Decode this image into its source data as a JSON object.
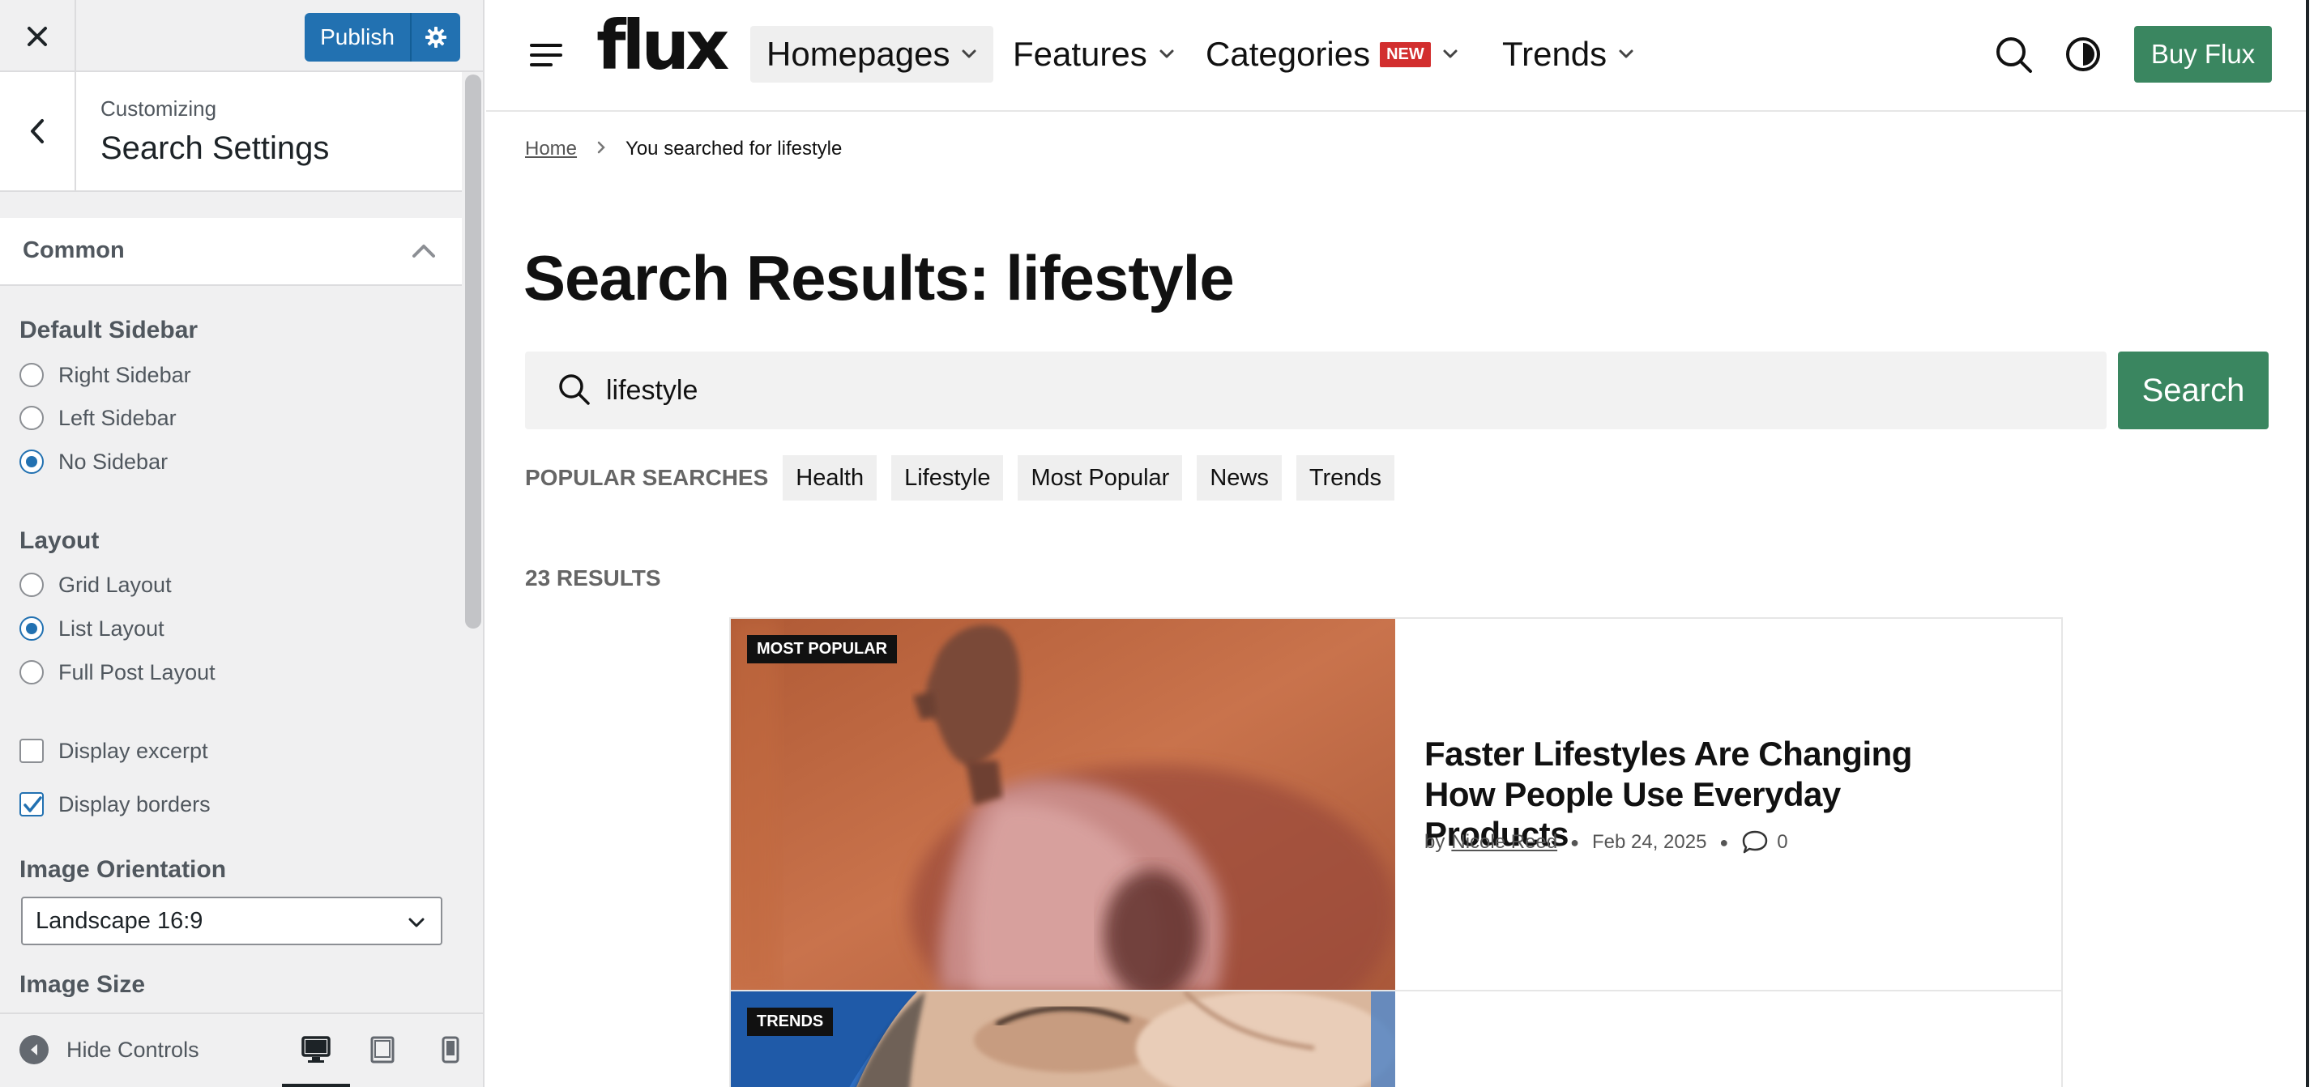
{
  "customizer": {
    "publish_label": "Publish",
    "customizing_label": "Customizing",
    "section_title": "Search Settings",
    "accordion_label": "Common",
    "default_sidebar": {
      "title": "Default Sidebar",
      "options": [
        "Right Sidebar",
        "Left Sidebar",
        "No Sidebar"
      ],
      "selected": "No Sidebar"
    },
    "layout": {
      "title": "Layout",
      "options": [
        "Grid Layout",
        "List Layout",
        "Full Post Layout"
      ],
      "selected": "List Layout"
    },
    "checkboxes": [
      {
        "label": "Display excerpt",
        "checked": false
      },
      {
        "label": "Display borders",
        "checked": true
      }
    ],
    "image_orientation": {
      "title": "Image Orientation",
      "value": "Landscape 16:9"
    },
    "image_size_title": "Image Size",
    "footer": {
      "hide_controls": "Hide Controls",
      "devices": [
        "desktop-icon",
        "tablet-icon",
        "mobile-icon"
      ],
      "active_device": "desktop"
    },
    "accent_color": "#2271b1"
  },
  "site": {
    "logo": "flux",
    "nav": [
      {
        "label": "Homepages",
        "active": true
      },
      {
        "label": "Features"
      },
      {
        "label": "Categories",
        "badge": "NEW"
      },
      {
        "label": "Trends"
      }
    ],
    "buy_button": "Buy Flux",
    "brand_color": "#3a8660",
    "breadcrumb": {
      "home": "Home",
      "current": "You searched for lifestyle"
    },
    "results_title": "Search Results: lifestyle",
    "search": {
      "value": "lifestyle",
      "button": "Search"
    },
    "popular": {
      "label": "POPULAR SEARCHES",
      "tags": [
        "Health",
        "Lifestyle",
        "Most Popular",
        "News",
        "Trends"
      ]
    },
    "results_count": "23 RESULTS",
    "posts": [
      {
        "badge": "MOST POPULAR",
        "title": "Faster Lifestyles Are Changing How People Use Everyday Products",
        "by": "by",
        "author": "Nicole Reed",
        "date": "Feb 24, 2025",
        "comments": "0"
      },
      {
        "badge": "TRENDS"
      }
    ]
  }
}
